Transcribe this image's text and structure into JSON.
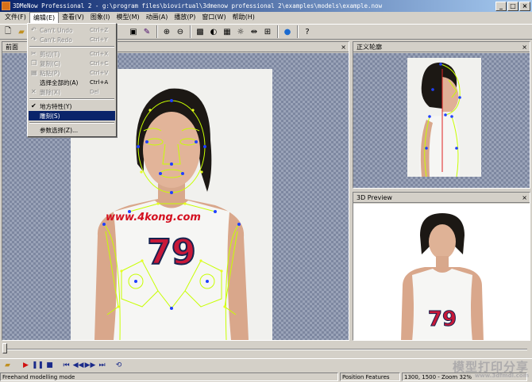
{
  "window": {
    "title": "3DMeNow Professional 2 - g:\\program files\\biovirtual\\3dmenow professional 2\\examples\\models\\example.now",
    "controls": [
      "_",
      "□",
      "×"
    ]
  },
  "menubar": [
    "文件(F)",
    "编辑(E)",
    "查看(V)",
    "图象(I)",
    "模型(M)",
    "动画(A)",
    "播放(P)",
    "窗口(W)",
    "帮助(H)"
  ],
  "edit_menu": {
    "items": [
      {
        "label": "Can't Undo",
        "key": "Ctrl+Z",
        "disabled": true,
        "icon": "↶"
      },
      {
        "label": "Can't Redo",
        "key": "Ctrl+Y",
        "disabled": true,
        "icon": "↷"
      },
      {
        "sep": true
      },
      {
        "label": "剪切(T)",
        "key": "Ctrl+X",
        "disabled": true,
        "icon": "✂"
      },
      {
        "label": "复制(C)",
        "key": "Ctrl+C",
        "disabled": true,
        "icon": "❐"
      },
      {
        "label": "粘贴(P)",
        "key": "Ctrl+V",
        "disabled": true,
        "icon": "▤"
      },
      {
        "label": "选择全部的(A)",
        "key": "Ctrl+A",
        "disabled": false,
        "icon": ""
      },
      {
        "label": "删除(X)",
        "key": "Del",
        "disabled": true,
        "icon": "✕"
      },
      {
        "sep": true
      },
      {
        "label": "地方特性(Y)",
        "key": "",
        "disabled": false,
        "icon": "✔"
      },
      {
        "label": "雕刻(S)",
        "key": "",
        "disabled": false,
        "icon": "",
        "highlight": true
      },
      {
        "sep": true
      },
      {
        "label": "参数选择(Z)...",
        "key": "",
        "disabled": false,
        "icon": ""
      }
    ]
  },
  "panes": {
    "front": {
      "title": "前面"
    },
    "profile": {
      "title": "正义轮廓"
    },
    "preview": {
      "title": "3D Preview"
    }
  },
  "overlay_text": {
    "url": "www.4kong.com",
    "jersey": "79"
  },
  "statusbar": {
    "mode": "Freehand modelling mode",
    "features": "Position Features",
    "coords": "1300, 1500 - Zoom 32%"
  },
  "watermark": {
    "main": "模型打印分享",
    "sub": "www.3dfmdl.com"
  },
  "colors": {
    "accent": "#0a246a",
    "outline": "#c8ff00",
    "point": "#2040ff",
    "jersey": "#d01030"
  }
}
